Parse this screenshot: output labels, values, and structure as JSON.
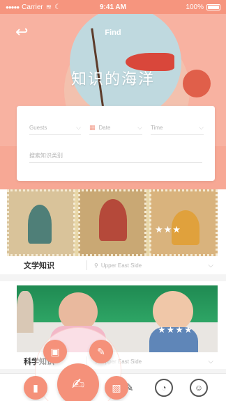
{
  "status_bar": {
    "carrier": "Carrier",
    "time": "9:41 AM",
    "battery": "100%"
  },
  "header": {
    "nav_title": "Find",
    "hero_title": "知识的海洋",
    "back_icon": "back-arrow-icon"
  },
  "search": {
    "guests_placeholder": "Guests",
    "date_placeholder": "Date",
    "time_placeholder": "Time",
    "topic_placeholder": "搜索知识类别"
  },
  "cards": [
    {
      "title": "文学知识",
      "location": "Upper East Side",
      "rating": 3
    },
    {
      "title": "科学知识",
      "location": "Upper East Side",
      "rating": 4
    }
  ],
  "colors": {
    "accent": "#f5917a",
    "status_bar": "#f6957e"
  },
  "tabbar": {
    "icons": [
      "home-icon",
      "brush-icon",
      "palette-icon",
      "profile-icon"
    ]
  },
  "fab_menu": {
    "icons": [
      "tv-icon",
      "pencil-icon",
      "edit-note-icon",
      "book-icon",
      "picture-icon"
    ]
  }
}
